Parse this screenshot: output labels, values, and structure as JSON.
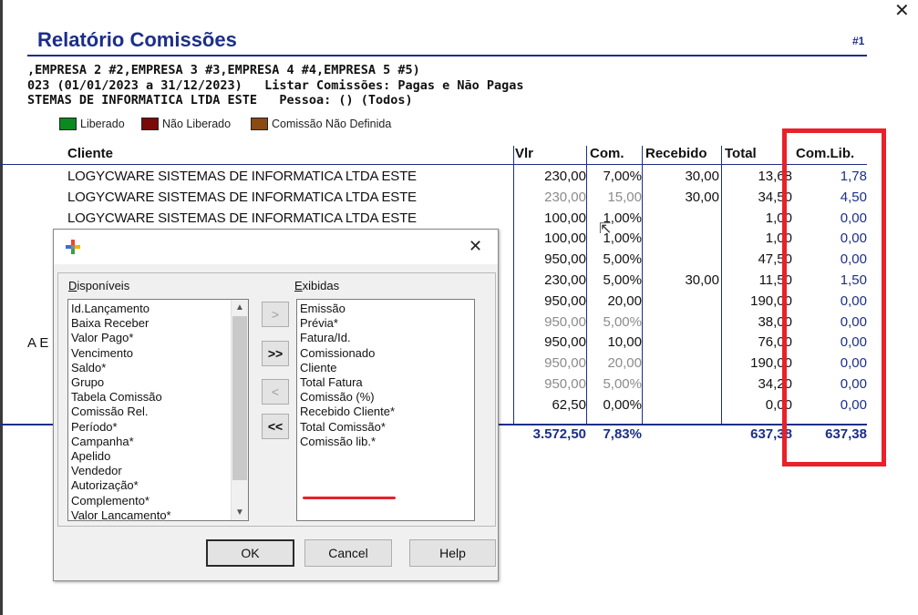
{
  "report": {
    "title": "Relatório Comissões",
    "page_number": "#1",
    "info_line1": ",EMPRESA 2 #2,EMPRESA 3 #3,EMPRESA 4 #4,EMPRESA 5 #5)",
    "info_line2": "023 (01/01/2023 a 31/12/2023)   Listar Comissões: Pagas e Não Pagas",
    "info_line3": "STEMAS DE INFORMATICA LTDA ESTE   Pessoa: () (Todos)",
    "side_fragment": "A E"
  },
  "legend": [
    {
      "label": "Liberado",
      "color": "#0a8a1f"
    },
    {
      "label": "Não Liberado",
      "color": "#7a0a0a"
    },
    {
      "label": "Comissão Não Definida",
      "color": "#8a4a12"
    }
  ],
  "table": {
    "headers": {
      "cliente": "Cliente",
      "vlr": "Vlr",
      "com": "Com.",
      "recebido": "Recebido",
      "total": "Total",
      "com_lib": "Com.Lib."
    },
    "rows": [
      {
        "cliente": "LOGYCWARE SISTEMAS DE INFORMATICA LTDA ESTE",
        "vlr": "230,00",
        "com": "7,00%",
        "recebido": "30,00",
        "total": "13,68",
        "com_lib": "1,78",
        "muted": false
      },
      {
        "cliente": "LOGYCWARE SISTEMAS DE INFORMATICA LTDA ESTE",
        "vlr": "230,00",
        "com": "15,00",
        "recebido": "30,00",
        "total": "34,50",
        "com_lib": "4,50",
        "muted": true
      },
      {
        "cliente": "LOGYCWARE SISTEMAS DE INFORMATICA LTDA ESTE",
        "vlr": "100,00",
        "com": "1,00%",
        "recebido": "",
        "total": "1,00",
        "com_lib": "0,00",
        "muted": false
      },
      {
        "cliente": "",
        "vlr": "100,00",
        "com": "1,00%",
        "recebido": "",
        "total": "1,00",
        "com_lib": "0,00",
        "muted": false
      },
      {
        "cliente": "",
        "vlr": "950,00",
        "com": "5,00%",
        "recebido": "",
        "total": "47,50",
        "com_lib": "0,00",
        "muted": false
      },
      {
        "cliente": "",
        "vlr": "230,00",
        "com": "5,00%",
        "recebido": "30,00",
        "total": "11,50",
        "com_lib": "1,50",
        "muted": false
      },
      {
        "cliente": "",
        "vlr": "950,00",
        "com": "20,00",
        "recebido": "",
        "total": "190,00",
        "com_lib": "0,00",
        "muted": false
      },
      {
        "cliente": "",
        "vlr": "950,00",
        "com": "5,00%",
        "recebido": "",
        "total": "38,00",
        "com_lib": "0,00",
        "muted": true
      },
      {
        "cliente": "",
        "vlr": "950,00",
        "com": "10,00",
        "recebido": "",
        "total": "76,00",
        "com_lib": "0,00",
        "muted": false
      },
      {
        "cliente": "",
        "vlr": "950,00",
        "com": "20,00",
        "recebido": "",
        "total": "190,00",
        "com_lib": "0,00",
        "muted": true
      },
      {
        "cliente": "",
        "vlr": "950,00",
        "com": "5,00%",
        "recebido": "",
        "total": "34,20",
        "com_lib": "0,00",
        "muted": true
      },
      {
        "cliente": "",
        "vlr": "62,50",
        "com": "0,00%",
        "recebido": "",
        "total": "0,00",
        "com_lib": "0,00",
        "muted": false
      }
    ],
    "totals": {
      "vlr": "3.572,50",
      "com": "7,83%",
      "total": "637,38",
      "com_lib": "637,38"
    }
  },
  "dialog": {
    "available_label": "Disponíveis",
    "available_mnemonic": "D",
    "available_rest": "isponíveis",
    "shown_mnemonic": "E",
    "shown_rest": "xibidas",
    "available": [
      "Id.Lançamento",
      "Baixa Receber",
      "Valor Pago*",
      "Vencimento",
      "Saldo*",
      "Grupo",
      "Tabela Comissão",
      "Comissão Rel.",
      "Período*",
      "Campanha*",
      "Apelido",
      "Vendedor",
      "Autorização*",
      "Complemento*",
      "Valor Lancamento*"
    ],
    "shown": [
      "Emissão",
      "Prévia*",
      "Fatura/Id.",
      "Comissionado",
      "Cliente",
      "Total Fatura",
      "Comissão (%)",
      "Recebido Cliente*",
      "Total Comissão*",
      "Comissão lib.*"
    ],
    "move_right": ">",
    "move_all_right": ">>",
    "move_left": "<",
    "move_all_left": "<<",
    "ok_label": "OK",
    "cancel_label": "Cancel",
    "help_label": "Help",
    "close_glyph": "✕"
  },
  "window": {
    "close_glyph": "✕"
  },
  "icons": {
    "dialog_icon": "colored-cross-icon",
    "scroll_up": "▲",
    "scroll_down": "▼"
  }
}
